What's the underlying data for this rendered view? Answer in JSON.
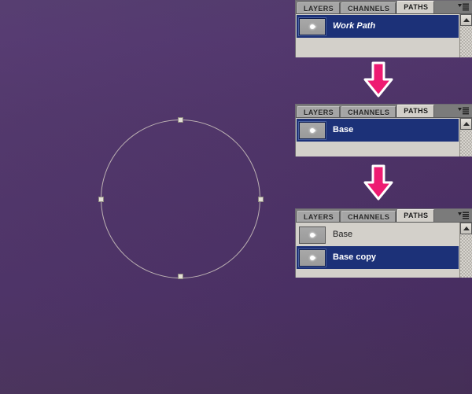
{
  "canvas": {
    "background_color_top": "#533a6e",
    "background_color_bottom": "#473059",
    "path_stroke_color": "#cfc7c0",
    "anchor_color": "#e4dfd6",
    "shape": "circle-path",
    "anchor_count": 4
  },
  "arrows": {
    "fill_color": "#ee1b72",
    "outline_color": "#ffffff",
    "direction": "down",
    "count": 2
  },
  "panels": [
    {
      "tabs": [
        {
          "label": "LAYERS",
          "active": false
        },
        {
          "label": "CHANNELS",
          "active": false
        },
        {
          "label": "PATHS",
          "active": true
        }
      ],
      "menu_icon": "panel-menu-icon",
      "rows": [
        {
          "label": "Work Path",
          "selected": true,
          "italic": true,
          "thumb_icon": "path-thumbnail-icon"
        }
      ]
    },
    {
      "tabs": [
        {
          "label": "LAYERS",
          "active": false
        },
        {
          "label": "CHANNELS",
          "active": false
        },
        {
          "label": "PATHS",
          "active": true
        }
      ],
      "menu_icon": "panel-menu-icon",
      "rows": [
        {
          "label": "Base",
          "selected": true,
          "italic": false,
          "thumb_icon": "path-thumbnail-icon"
        }
      ]
    },
    {
      "tabs": [
        {
          "label": "LAYERS",
          "active": false
        },
        {
          "label": "CHANNELS",
          "active": false
        },
        {
          "label": "PATHS",
          "active": true
        }
      ],
      "menu_icon": "panel-menu-icon",
      "rows": [
        {
          "label": "Base",
          "selected": false,
          "italic": false,
          "thumb_icon": "path-thumbnail-icon"
        },
        {
          "label": "Base copy",
          "selected": true,
          "italic": false,
          "thumb_icon": "path-thumbnail-icon"
        }
      ]
    }
  ]
}
